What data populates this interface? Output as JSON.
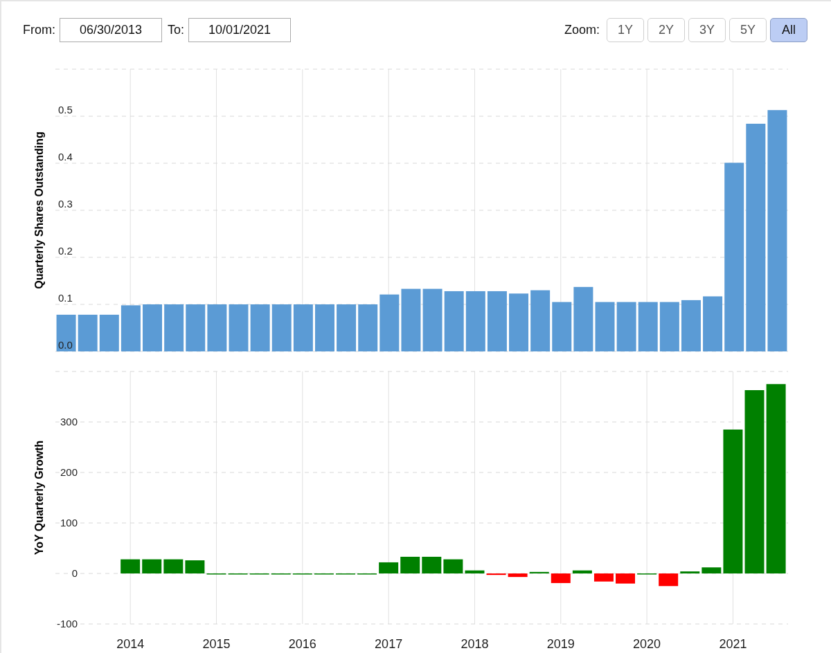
{
  "date_range": {
    "from_label": "From:",
    "from_value": "06/30/2013",
    "to_label": "To:",
    "to_value": "10/01/2021"
  },
  "zoom": {
    "label": "Zoom:",
    "options": [
      {
        "label": "1Y",
        "selected": false
      },
      {
        "label": "2Y",
        "selected": false
      },
      {
        "label": "3Y",
        "selected": false
      },
      {
        "label": "5Y",
        "selected": false
      },
      {
        "label": "All",
        "selected": true
      }
    ]
  },
  "charts": [
    {
      "chart_data": {
        "type": "bar",
        "ylabel": "Quarterly Shares Outstanding",
        "grid": true,
        "values": [
          0.078,
          0.078,
          0.078,
          0.098,
          0.1,
          0.1,
          0.1,
          0.1,
          0.1,
          0.1,
          0.1,
          0.1,
          0.1,
          0.1,
          0.1,
          0.121,
          0.133,
          0.133,
          0.128,
          0.128,
          0.128,
          0.123,
          0.13,
          0.105,
          0.137,
          0.105,
          0.105,
          0.105,
          0.105,
          0.109,
          0.117,
          0.401,
          0.484,
          0.513
        ],
        "ylim": [
          0,
          0.6
        ],
        "yticks": [
          {
            "value": 0,
            "label": "0.0"
          },
          {
            "value": 0.1,
            "label": "0.1"
          },
          {
            "value": 0.2,
            "label": "0.2"
          },
          {
            "value": 0.3,
            "label": "0.3"
          },
          {
            "value": 0.4,
            "label": "0.4"
          },
          {
            "value": 0.5,
            "label": "0.5"
          }
        ]
      }
    },
    {
      "chart_data": {
        "type": "bar",
        "ylabel": "YoY Quarterly Growth",
        "grid": true,
        "stacked": true,
        "x": [
          2014,
          2014.25,
          2014.5,
          2014.75,
          2015,
          2015.25,
          2015.5,
          2015.75,
          2016,
          2016.25,
          2016.5,
          2016.75,
          2017,
          2017.25,
          2017.5,
          2017.75,
          2018,
          2018.25,
          2018.5,
          2018.75,
          2019,
          2019.25,
          2019.5,
          2019.75,
          2020,
          2020.25,
          2020.5,
          2020.75,
          2021,
          2021.25,
          2021.5
        ],
        "series": [
          {
            "color": "#008000",
            "values": [
              28,
              28,
              28,
              26,
              0,
              0,
              0,
              0,
              0,
              0,
              0,
              0,
              22,
              33,
              33,
              28,
              6,
              null,
              null,
              3,
              null,
              6,
              null,
              null,
              0,
              null,
              4,
              12,
              285,
              363,
              375
            ]
          },
          {
            "color": "#ff0000",
            "values": [
              null,
              null,
              null,
              null,
              null,
              null,
              null,
              null,
              null,
              null,
              null,
              null,
              null,
              null,
              null,
              null,
              null,
              -3,
              -7,
              null,
              -19,
              null,
              -16,
              -20,
              null,
              -25,
              null,
              null,
              null,
              null,
              null
            ]
          }
        ],
        "xlim": [
          2013.13,
          2021.64
        ],
        "ylim": [
          -100,
          400
        ],
        "yticks": [
          {
            "value": -100,
            "label": "-100"
          },
          {
            "value": 0,
            "label": "0"
          },
          {
            "value": 100,
            "label": "100"
          },
          {
            "value": 200,
            "label": "200"
          },
          {
            "value": 300,
            "label": "300"
          }
        ],
        "xticks": [
          2014,
          2015,
          2016,
          2017,
          2018,
          2019,
          2020,
          2021
        ]
      }
    }
  ]
}
